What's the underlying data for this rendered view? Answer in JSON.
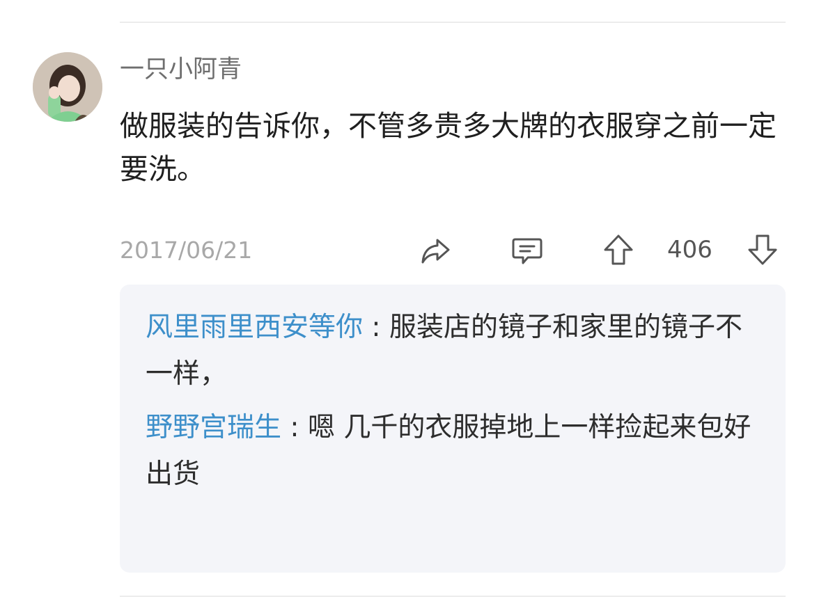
{
  "comment": {
    "username": "一只小阿青",
    "text": "做服装的告诉你，不管多贵多大牌的衣服穿之前一定要洗。",
    "date": "2017/06/21",
    "vote_count": "406",
    "icons": {
      "share": "share-icon",
      "reply": "reply-icon",
      "upvote": "arrow-up-icon",
      "downvote": "arrow-down-icon"
    }
  },
  "replies": [
    {
      "author": "风里雨里西安等你",
      "separator": " : ",
      "text": "服装店的镜子和家里的镜子不一样，"
    },
    {
      "author": "野野宫瑞生",
      "separator": " : ",
      "text": "嗯 几千的衣服掉地上一样捡起来包好出货"
    }
  ],
  "colors": {
    "reply_author": "#3d8fca",
    "reply_box_bg": "#f4f5f9",
    "muted_text": "#a8a8a8"
  }
}
